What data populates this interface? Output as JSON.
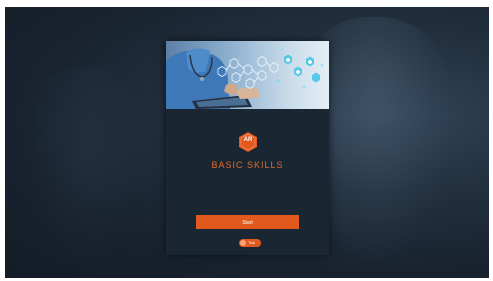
{
  "app": {
    "logo_text": "AR",
    "title": "BASIC SKILLS"
  },
  "actions": {
    "start_label": "Start"
  },
  "language_toggle": {
    "label": "Tisk"
  },
  "colors": {
    "accent": "#e2591e",
    "title": "#e06a2c",
    "background": "#18222e",
    "card": "#1b2633"
  },
  "icons": [
    "medical-hexagon-icon"
  ]
}
